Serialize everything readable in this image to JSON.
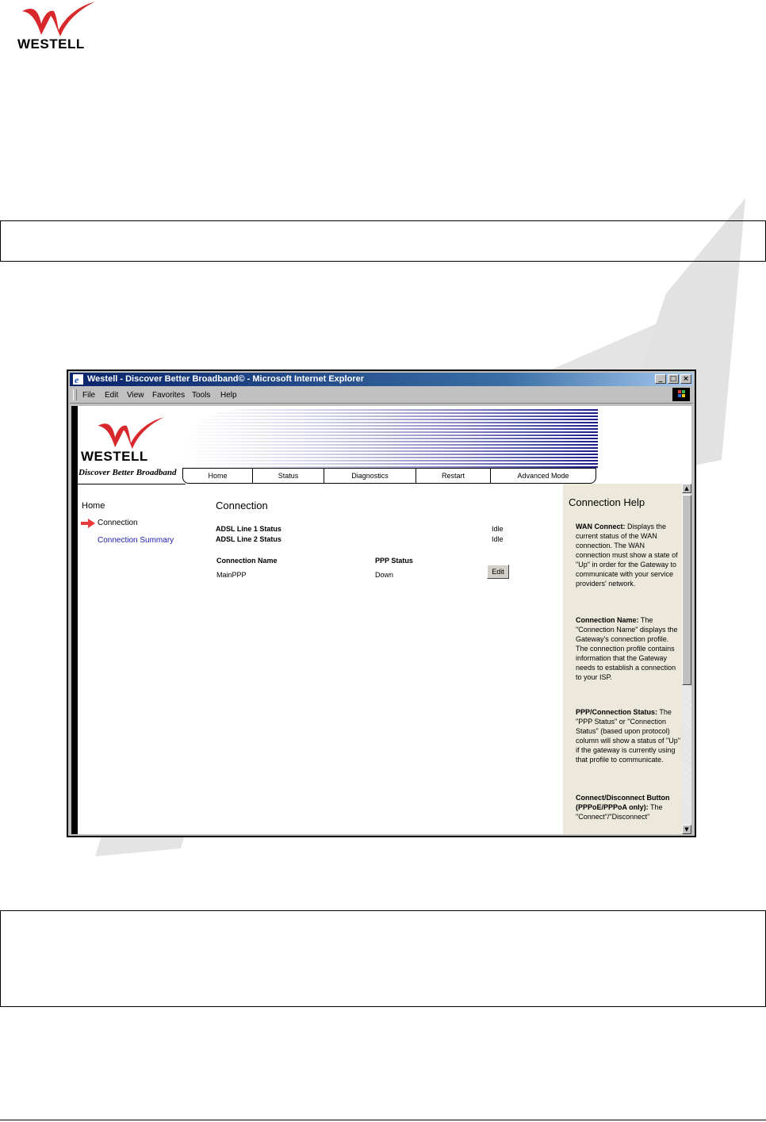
{
  "header": {
    "brand": "WESTELL"
  },
  "window": {
    "title": "Westell - Discover Better Broadband© - Microsoft Internet Explorer",
    "controls": {
      "minimize": "_",
      "maximize": "□",
      "close": "×"
    }
  },
  "menubar": {
    "items": [
      "File",
      "Edit",
      "View",
      "Favorites",
      "Tools",
      "Help"
    ]
  },
  "page": {
    "brand": "WESTELL",
    "tagline": "Discover Better Broadband",
    "nav": [
      "Home",
      "Status",
      "Diagnostics",
      "Restart",
      "Advanced Mode"
    ],
    "sidebar": {
      "title": "Home",
      "items": [
        {
          "label": "Connection",
          "active": true
        },
        {
          "label": "Connection Summary",
          "active": false
        }
      ]
    },
    "main": {
      "title": "Connection",
      "adsl1_label": "ADSL Line 1 Status",
      "adsl1_value": "Idle",
      "adsl2_label": "ADSL Line 2 Status",
      "adsl2_value": "Idle",
      "col_name": "Connection Name",
      "col_status": "PPP Status",
      "row_name": "MainPPP",
      "row_status": "Down",
      "edit_label": "Edit"
    },
    "help": {
      "title": "Connection Help",
      "sections": [
        {
          "heading": "WAN Connect:",
          "body": " Displays the current status of the WAN connection. The WAN connection must show a state of \"Up\" in order for the Gateway to communicate with your service providers' network."
        },
        {
          "heading": "Connection Name:",
          "body": " The \"Connection Name\" displays the Gateway's connection profile. The connection profile contains information that the Gateway needs to establish a connection to your ISP."
        },
        {
          "heading": "PPP/Connection Status:",
          "body": " The \"PPP Status\" or \"Connection Status\" (based upon protocol) column will show a status of \"Up\" if the gateway is currently using that profile to communicate."
        },
        {
          "heading": "Connect/Disconnect Button (PPPoE/PPPoA only):",
          "body": " The \"Connect\"/\"Disconnect\""
        }
      ]
    }
  },
  "colors": {
    "accent_red": "#d8282b",
    "link_blue": "#1a1aa6",
    "title_bar": "#0a246a"
  }
}
